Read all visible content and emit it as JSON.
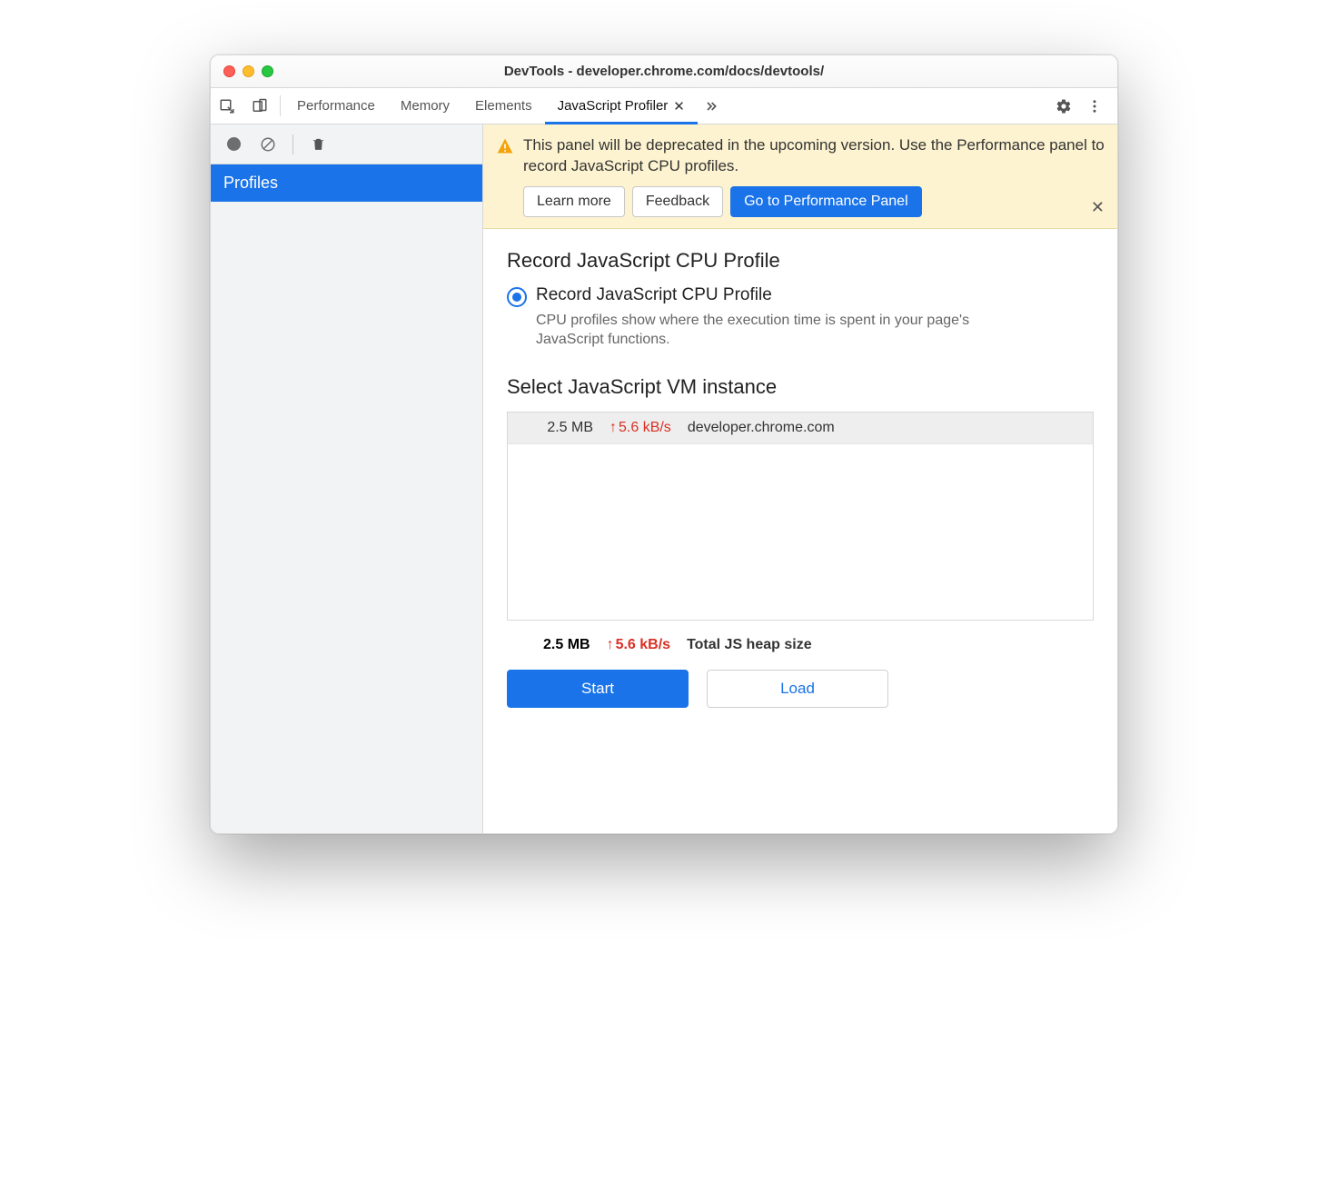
{
  "window": {
    "title": "DevTools - developer.chrome.com/docs/devtools/"
  },
  "tabs": {
    "items": [
      "Performance",
      "Memory",
      "Elements",
      "JavaScript Profiler"
    ],
    "activeIndex": 3
  },
  "sidebar": {
    "selected_label": "Profiles"
  },
  "banner": {
    "text": "This panel will be deprecated in the upcoming version. Use the Performance panel to record JavaScript CPU profiles.",
    "learn_more": "Learn more",
    "feedback": "Feedback",
    "goto_perf": "Go to Performance Panel"
  },
  "profile": {
    "heading": "Record JavaScript CPU Profile",
    "radio_label": "Record JavaScript CPU Profile",
    "radio_desc": "CPU profiles show where the execution time is spent in your page's JavaScript functions."
  },
  "vm": {
    "heading": "Select JavaScript VM instance",
    "rows": [
      {
        "size": "2.5 MB",
        "rate": "5.6 kB/s",
        "host": "developer.chrome.com"
      }
    ],
    "total_size": "2.5 MB",
    "total_rate": "5.6 kB/s",
    "total_label": "Total JS heap size"
  },
  "actions": {
    "start": "Start",
    "load": "Load"
  }
}
